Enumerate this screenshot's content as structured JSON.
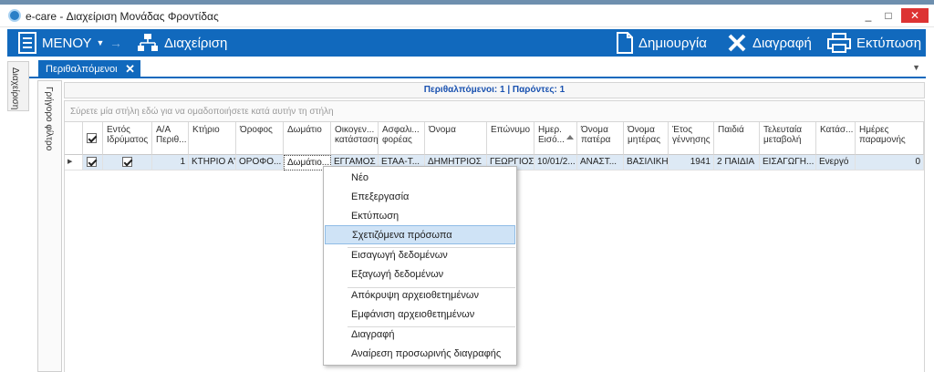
{
  "window": {
    "title": "e-care - Διαχείριση Μονάδας Φροντίδας",
    "min": "_",
    "max": "□",
    "close": "✕"
  },
  "toolbar": {
    "menu": "ΜΕΝΟΥ",
    "manage": "Διαχείριση",
    "create": "Δημιουργία",
    "delete": "Διαγραφή",
    "print": "Εκτύπωση"
  },
  "tab": {
    "label": "Περιθαλπόμενοι",
    "close": "✕"
  },
  "side": {
    "manage": "Διαχείριση",
    "quick_filter": "Γρήγορο φίλτρο"
  },
  "summary": "Περιθαλπόμενοι: 1 | Παρόντες: 1",
  "group_hint": "Σύρετε μία στήλη εδώ για να ομαδοποιήσετε κατά αυτήν τη στήλη",
  "columns": [
    "Εντός Ιδρύματος",
    "Α/Α Περιθ...",
    "Κτήριο",
    "Όροφος",
    "Δωμάτιο",
    "Οικογεν... κατάσταση",
    "Ασφαλι... φορέας",
    "Όνομα",
    "Επώνυμο",
    "Ημερ. Εισό...",
    "Όνομα πατέρα",
    "Όνομα μητέρας",
    "Έτος γέννησης",
    "Παιδιά",
    "Τελευταία μεταβολή",
    "Κατάσ...",
    "Ημέρες παραμονής"
  ],
  "row": {
    "aa": "1",
    "building": "ΚΤΗΡΙΟ Α'",
    "floor": "ΟΡΟΦΟ...",
    "room": "Δωμάτιο...",
    "marital": "ΕΓΓΑΜΟΣ",
    "insurance": "ΕΤΑΑ-Τ...",
    "name": "ΔΗΜΗΤΡΙΟΣ",
    "surname": "ΓΕΩΡΓΙΟΣ",
    "entry_date": "10/01/2...",
    "father": "ΑΝΑΣΤ...",
    "mother": "ΒΑΣΙΛΙΚΗ",
    "birth_year": "1941",
    "children": "2 ΠΑΙΔΙΑ",
    "last_change": "ΕΙΣΑΓΩΓΗ...",
    "status": "Ενεργό",
    "days": "0"
  },
  "context_menu": [
    "Νέο",
    "Επεξεργασία",
    "Εκτύπωση",
    "Σχετιζόμενα πρόσωπα",
    "Εισαγωγή δεδομένων",
    "Εξαγωγή δεδομένων",
    "Απόκρυψη αρχειοθετημένων",
    "Εμφάνιση αρχειοθετημένων",
    "Διαγραφή",
    "Αναίρεση προσωρινής διαγραφής"
  ],
  "colors": {
    "accent": "#1169bd",
    "row_selected": "#dde9f5",
    "menu_highlight": "#cfe3f6"
  }
}
